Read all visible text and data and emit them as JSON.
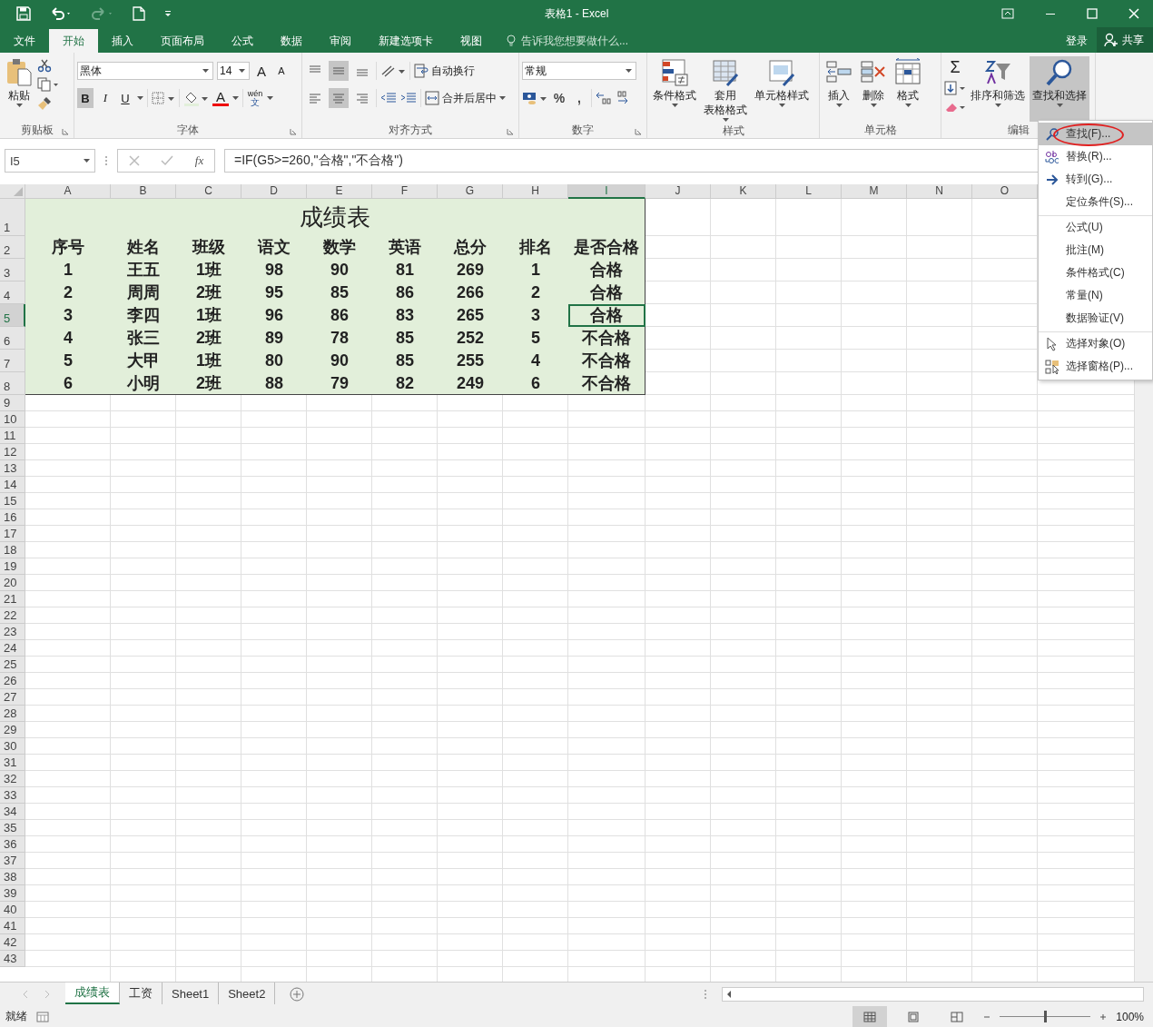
{
  "title_bar": {
    "title": "表格1 - Excel"
  },
  "menu_tabs": [
    {
      "label": "文件",
      "selected": false
    },
    {
      "label": "开始",
      "selected": true
    },
    {
      "label": "插入",
      "selected": false
    },
    {
      "label": "页面布局",
      "selected": false
    },
    {
      "label": "公式",
      "selected": false
    },
    {
      "label": "数据",
      "selected": false
    },
    {
      "label": "审阅",
      "selected": false
    },
    {
      "label": "新建选项卡",
      "selected": false
    },
    {
      "label": "视图",
      "selected": false
    }
  ],
  "tell_me": {
    "placeholder": "告诉我您想要做什么..."
  },
  "sign_in": "登录",
  "share": "共享",
  "ribbon": {
    "clipboard": {
      "label": "剪贴板",
      "paste": "粘贴"
    },
    "font": {
      "label": "字体",
      "name": "黑体",
      "size": "14",
      "grow": "A",
      "shrink": "A",
      "font_color": "A",
      "phonetic": "wén",
      "phonetic_sub": "文",
      "style_buttons": [
        {
          "label": "B",
          "kind": "bold",
          "pressed": true
        },
        {
          "label": "I",
          "kind": "italic",
          "pressed": false
        },
        {
          "label": "U",
          "kind": "underline",
          "pressed": false
        }
      ]
    },
    "alignment": {
      "label": "对齐方式",
      "wrap": "自动换行",
      "merge": "合并后居中",
      "vertical": [
        {
          "kind": "top",
          "selected": false
        },
        {
          "kind": "middle",
          "selected": true
        },
        {
          "kind": "bottom",
          "selected": false
        }
      ],
      "horizontal": [
        {
          "kind": "left",
          "selected": false
        },
        {
          "kind": "center",
          "selected": true
        },
        {
          "kind": "right",
          "selected": false
        }
      ]
    },
    "number": {
      "label": "数字",
      "format": "常规",
      "percent": "%",
      "comma": ","
    },
    "styles": {
      "label": "样式",
      "buttons": [
        {
          "kind": "conditional",
          "lines": [
            "条件格式"
          ]
        },
        {
          "kind": "table",
          "lines": [
            "套用",
            "表格格式"
          ]
        },
        {
          "kind": "cell",
          "lines": [
            "单元格样式"
          ]
        }
      ]
    },
    "cells": {
      "label": "单元格",
      "buttons": [
        {
          "kind": "insert",
          "label": "插入"
        },
        {
          "kind": "delete",
          "label": "删除"
        },
        {
          "kind": "format",
          "label": "格式"
        }
      ]
    },
    "editing": {
      "label": "编辑",
      "sum": "Σ",
      "sort": "排序和筛选",
      "find": {
        "label": "查找和选择",
        "pressed": true
      }
    }
  },
  "formula_bar": {
    "name_box": "I5",
    "fx": "fx",
    "formula": "=IF(G5>=260,\"合格\",\"不合格\")"
  },
  "sheet": {
    "columns": [
      {
        "label": "A",
        "selected": false
      },
      {
        "label": "B",
        "selected": false
      },
      {
        "label": "C",
        "selected": false
      },
      {
        "label": "D",
        "selected": false
      },
      {
        "label": "E",
        "selected": false
      },
      {
        "label": "F",
        "selected": false
      },
      {
        "label": "G",
        "selected": false
      },
      {
        "label": "H",
        "selected": false
      },
      {
        "label": "I",
        "selected": true
      },
      {
        "label": "J",
        "selected": false
      },
      {
        "label": "K",
        "selected": false
      },
      {
        "label": "L",
        "selected": false
      },
      {
        "label": "M",
        "selected": false
      },
      {
        "label": "N",
        "selected": false
      },
      {
        "label": "O",
        "selected": false
      }
    ],
    "rows": [
      {
        "label": "1",
        "selected": false
      },
      {
        "label": "2",
        "selected": false
      },
      {
        "label": "3",
        "selected": false
      },
      {
        "label": "4",
        "selected": false
      },
      {
        "label": "5",
        "selected": true
      },
      {
        "label": "6",
        "selected": false
      },
      {
        "label": "7",
        "selected": false
      },
      {
        "label": "8",
        "selected": false
      },
      {
        "label": "9",
        "selected": false
      },
      {
        "label": "10",
        "selected": false
      },
      {
        "label": "11",
        "selected": false
      },
      {
        "label": "12",
        "selected": false
      },
      {
        "label": "13",
        "selected": false
      },
      {
        "label": "14",
        "selected": false
      },
      {
        "label": "15",
        "selected": false
      },
      {
        "label": "16",
        "selected": false
      },
      {
        "label": "17",
        "selected": false
      },
      {
        "label": "18",
        "selected": false
      },
      {
        "label": "19",
        "selected": false
      },
      {
        "label": "20",
        "selected": false
      },
      {
        "label": "21",
        "selected": false
      },
      {
        "label": "22",
        "selected": false
      },
      {
        "label": "23",
        "selected": false
      },
      {
        "label": "24",
        "selected": false
      },
      {
        "label": "25",
        "selected": false
      },
      {
        "label": "26",
        "selected": false
      },
      {
        "label": "27",
        "selected": false
      },
      {
        "label": "28",
        "selected": false
      },
      {
        "label": "29",
        "selected": false
      },
      {
        "label": "30",
        "selected": false
      },
      {
        "label": "31",
        "selected": false
      },
      {
        "label": "32",
        "selected": false
      },
      {
        "label": "33",
        "selected": false
      },
      {
        "label": "34",
        "selected": false
      },
      {
        "label": "35",
        "selected": false
      },
      {
        "label": "36",
        "selected": false
      },
      {
        "label": "37",
        "selected": false
      },
      {
        "label": "38",
        "selected": false
      },
      {
        "label": "39",
        "selected": false
      },
      {
        "label": "40",
        "selected": false
      },
      {
        "label": "41",
        "selected": false
      },
      {
        "label": "42",
        "selected": false
      },
      {
        "label": "43",
        "selected": false
      }
    ],
    "table_title": "成绩表",
    "header": [
      "序号",
      "姓名",
      "班级",
      "语文",
      "数学",
      "英语",
      "总分",
      "排名",
      "是否合格"
    ],
    "data": [
      [
        "1",
        "王五",
        "1班",
        "98",
        "90",
        "81",
        "269",
        "1",
        "合格"
      ],
      [
        "2",
        "周周",
        "2班",
        "95",
        "85",
        "86",
        "266",
        "2",
        "合格"
      ],
      [
        "3",
        "李四",
        "1班",
        "96",
        "86",
        "83",
        "265",
        "3",
        "合格"
      ],
      [
        "4",
        "张三",
        "2班",
        "89",
        "78",
        "85",
        "252",
        "5",
        "不合格"
      ],
      [
        "5",
        "大甲",
        "1班",
        "80",
        "90",
        "85",
        "255",
        "4",
        "不合格"
      ],
      [
        "6",
        "小明",
        "2班",
        "88",
        "79",
        "82",
        "249",
        "6",
        "不合格"
      ]
    ]
  },
  "dropdown": [
    {
      "label": "查找(F)...",
      "kind": "find",
      "selected": true,
      "circled": true,
      "divider_before": false
    },
    {
      "label": "替换(R)...",
      "kind": "replace",
      "selected": false,
      "circled": false,
      "divider_before": false
    },
    {
      "label": "转到(G)...",
      "kind": "goto",
      "selected": false,
      "circled": false,
      "divider_before": false
    },
    {
      "label": "定位条件(S)...",
      "kind": "plain",
      "selected": false,
      "circled": false,
      "divider_before": false
    },
    {
      "label": "公式(U)",
      "kind": "plain",
      "selected": false,
      "circled": false,
      "divider_before": true
    },
    {
      "label": "批注(M)",
      "kind": "plain",
      "selected": false,
      "circled": false,
      "divider_before": false
    },
    {
      "label": "条件格式(C)",
      "kind": "plain",
      "selected": false,
      "circled": false,
      "divider_before": false
    },
    {
      "label": "常量(N)",
      "kind": "plain",
      "selected": false,
      "circled": false,
      "divider_before": false
    },
    {
      "label": "数据验证(V)",
      "kind": "plain",
      "selected": false,
      "circled": false,
      "divider_before": false
    },
    {
      "label": "选择对象(O)",
      "kind": "pointer",
      "selected": false,
      "circled": false,
      "divider_before": true
    },
    {
      "label": "选择窗格(P)...",
      "kind": "pane",
      "selected": false,
      "circled": false,
      "divider_before": false
    }
  ],
  "sheet_tabs": [
    {
      "label": "成绩表",
      "selected": true
    },
    {
      "label": "工资",
      "selected": false
    },
    {
      "label": "Sheet1",
      "selected": false
    },
    {
      "label": "Sheet2",
      "selected": false
    }
  ],
  "status_bar": {
    "status": "就绪",
    "views": [
      {
        "kind": "normal",
        "selected": true
      },
      {
        "kind": "layout",
        "selected": false
      },
      {
        "kind": "pagebreak",
        "selected": false
      }
    ],
    "zoom": {
      "level": 0.5,
      "reading": "100%"
    }
  }
}
